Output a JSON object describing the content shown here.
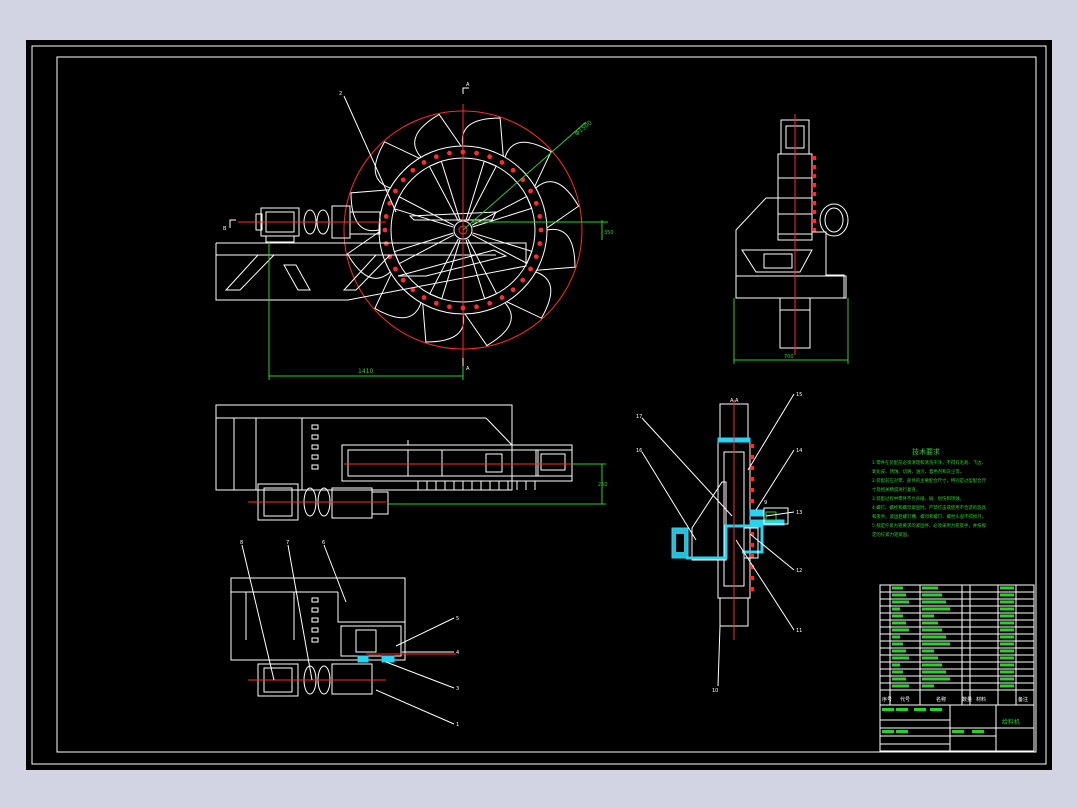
{
  "drawing": {
    "tech_requirements": {
      "title": "技术要求",
      "lines": [
        "1.零件在装配前必须清理和清洗干净，不得有毛刺、飞边、",
        "   氧化皮、锈蚀、切屑、油污、着色剂和灰尘等。",
        "2.装配前应对零、部件的主要配合尺寸，特别是过盈配合尺",
        "   寸及相关精度进行复查。",
        "3.装配过程中零件不允许磕、碰、划伤和锈蚀。",
        "4.螺钉、螺栓和螺母紧固时，严禁打击或使用不合适的旋具",
        "   和扳手。紧固后螺钉槽、螺母和螺钉、螺栓头部不得损坏。",
        "5.规定拧紧力矩要求的紧固件，必须采用力矩扳手，并按规",
        "   定的拧紧力矩紧固。"
      ]
    },
    "front_view": {
      "dim_horizontal": "1410",
      "dim_radius": "Φ1500",
      "dim_height": "350",
      "section_mark_top": "A",
      "section_mark_bottom": "A",
      "section_mark_side": "B",
      "balloon": "2"
    },
    "side_view": {
      "dim_width": "700"
    },
    "plan_view": {
      "dim_offset": "260"
    },
    "lower_plan_view": {
      "balloons": [
        "8",
        "7",
        "6",
        "5",
        "4",
        "3",
        "1"
      ]
    },
    "section_view": {
      "top_label": "A-A",
      "balloons": [
        "17",
        "16",
        "15",
        "14",
        "13",
        "12",
        "11",
        "10",
        "9"
      ]
    },
    "title_block": {
      "drawing_name": "给料机",
      "header_cols": [
        "序号",
        "代号",
        "名称",
        "数量",
        "材料",
        "备注"
      ]
    }
  }
}
